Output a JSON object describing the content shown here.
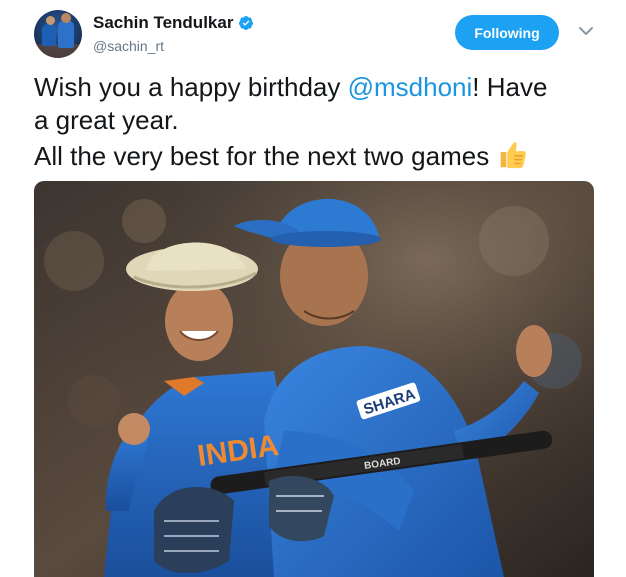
{
  "author": {
    "name": "Sachin Tendulkar",
    "handle": "@sachin_rt",
    "verified": true,
    "avatar": "profile-photo"
  },
  "actions": {
    "follow_label": "Following",
    "menu_icon": "chevron-down-icon"
  },
  "tweet": {
    "line1_before": "Wish you a happy birthday ",
    "mention": "@msdhoni",
    "line1_after": "! Have",
    "line2": "a great year.",
    "line3": "All the very best for the next two games",
    "emoji": "thumbs-up-icon"
  },
  "media": {
    "kit_text": "INDIA",
    "sponsor_text": "SHARA",
    "stump_text": "BOARD"
  },
  "colors": {
    "accent": "#1da1f2",
    "mention": "#1b95e0",
    "muted": "#657786",
    "kit_blue": "#1f5fb8"
  }
}
